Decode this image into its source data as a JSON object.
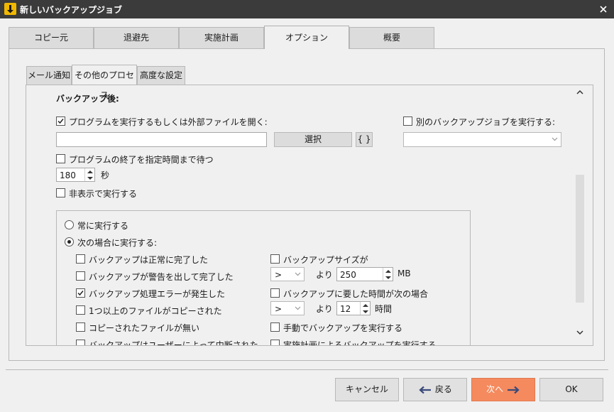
{
  "window": {
    "title": "新しいバックアップジョブ"
  },
  "main_tabs": [
    {
      "label": "コピー元"
    },
    {
      "label": "退避先"
    },
    {
      "label": "実施計画"
    },
    {
      "label": "オプション"
    },
    {
      "label": "概要"
    }
  ],
  "sub_tabs": [
    {
      "label": "メール通知"
    },
    {
      "label": "その他のプロセス"
    },
    {
      "label": "高度な設定"
    }
  ],
  "after_backup": {
    "heading": "バックアップ後:",
    "run_program": {
      "label": "プログラムを実行するもしくは外部ファイルを開く:",
      "checked": true
    },
    "program_path": {
      "value": ""
    },
    "select_button": "選択",
    "vars_button": "{ }",
    "run_other_job": {
      "label": "別のバックアップジョブを実行する:",
      "checked": false
    },
    "other_job_select": {
      "value": ""
    },
    "wait_until": {
      "label": "プログラムの終了を指定時間まで待つ",
      "checked": false
    },
    "wait_seconds": {
      "value": "180",
      "unit": "秒"
    },
    "run_hidden": {
      "label": "非表示で実行する",
      "checked": false
    }
  },
  "conditions": {
    "always": {
      "label": "常に実行する",
      "selected": false
    },
    "when": {
      "label": "次の場合に実行する:",
      "selected": true
    },
    "left": [
      {
        "label": "バックアップは正常に完了した",
        "checked": false
      },
      {
        "label": "バックアップが警告を出して完了した",
        "checked": false
      },
      {
        "label": "バックアップ処理エラーが発生した",
        "checked": true
      },
      {
        "label": "1つ以上のファイルがコピーされた",
        "checked": false
      },
      {
        "label": "コピーされたファイルが無い",
        "checked": false
      },
      {
        "label": "バックアップはユーザーによって中断された",
        "checked": false
      }
    ],
    "right": {
      "size": {
        "label": "バックアップサイズが",
        "checked": false,
        "op": ">",
        "than": "より",
        "value": "250",
        "unit": "MB"
      },
      "time": {
        "label": "バックアップに要した時間が次の場合",
        "checked": false,
        "op": ">",
        "than": "より",
        "value": "12",
        "unit": "時間"
      },
      "manual": {
        "label": "手動でバックアップを実行する",
        "checked": false
      },
      "scheduled": {
        "label": "実施計画によるバックアップを実行する",
        "checked": false
      }
    }
  },
  "buttons": {
    "cancel": "キャンセル",
    "back": "戻る",
    "next": "次へ",
    "ok": "OK"
  },
  "colors": {
    "titlebar": "#3b3b3b",
    "primary": "#f58a5e",
    "app_icon": "#f0b800"
  }
}
